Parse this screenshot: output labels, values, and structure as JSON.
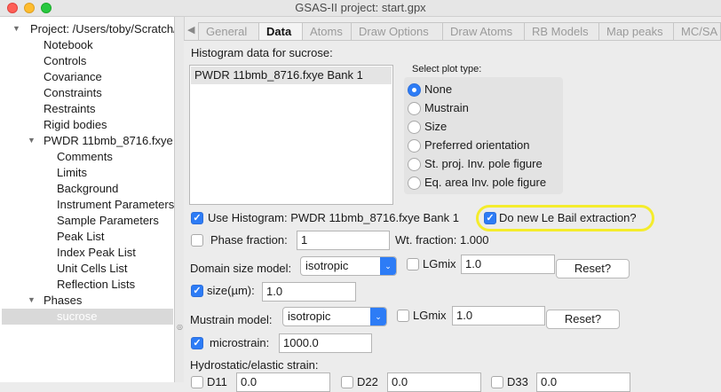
{
  "window": {
    "title": "GSAS-II project: start.gpx"
  },
  "tree": {
    "project": "Project: /Users/toby/Scratch/",
    "items": [
      "Notebook",
      "Controls",
      "Covariance",
      "Constraints",
      "Restraints",
      "Rigid bodies"
    ],
    "pwdr": "PWDR 11bmb_8716.fxye",
    "pwdr_items": [
      "Comments",
      "Limits",
      "Background",
      "Instrument Parameters",
      "Sample Parameters",
      "Peak List",
      "Index Peak List",
      "Unit Cells List",
      "Reflection Lists"
    ],
    "phases": "Phases",
    "phase_items": [
      "sucrose"
    ]
  },
  "tabs": [
    "General",
    "Data",
    "Atoms",
    "Draw Options",
    "Draw Atoms",
    "RB Models",
    "Map peaks",
    "MC/SA"
  ],
  "data_tab": {
    "histogram_header": "Histogram data for sucrose:",
    "histograms": [
      "PWDR 11bmb_8716.fxye Bank 1"
    ],
    "plot_type_label": "Select plot type:",
    "plot_types": [
      "None",
      "Mustrain",
      "Size",
      "Preferred orientation",
      "St. proj. Inv. pole figure",
      "Eq. area Inv. pole figure"
    ],
    "plot_type_selected": "None",
    "use_histogram_label": "Use Histogram: PWDR 11bmb_8716.fxye Bank 1",
    "use_histogram_checked": true,
    "le_bail_label": "Do new Le Bail extraction?",
    "le_bail_checked": true,
    "phase_fraction_label": "Phase fraction:",
    "phase_fraction_checked": false,
    "phase_fraction_value": "1",
    "wt_fraction": "Wt. fraction: 1.000",
    "domain_size_label": "Domain size model:",
    "domain_size_model": "isotropic",
    "domain_lgmix_label": "LGmix",
    "domain_lgmix_checked": false,
    "domain_lgmix_value": "1.0",
    "reset_label": "Reset?",
    "size_label": "size(µm):",
    "size_checked": true,
    "size_value": "1.0",
    "mustrain_label": "Mustrain model:",
    "mustrain_model": "isotropic",
    "mustrain_lgmix_label": "LGmix",
    "mustrain_lgmix_checked": false,
    "mustrain_lgmix_value": "1.0",
    "microstrain_label": "microstrain:",
    "microstrain_checked": true,
    "microstrain_value": "1000.0",
    "hydrostatic_label": "Hydrostatic/elastic strain:",
    "strain_fields": [
      {
        "label": "D11",
        "value": "0.0"
      },
      {
        "label": "D22",
        "value": "0.0"
      },
      {
        "label": "D33",
        "value": "0.0"
      }
    ]
  },
  "colors": {
    "accent": "#2d7cf6",
    "highlight": "#f4ec2c"
  }
}
